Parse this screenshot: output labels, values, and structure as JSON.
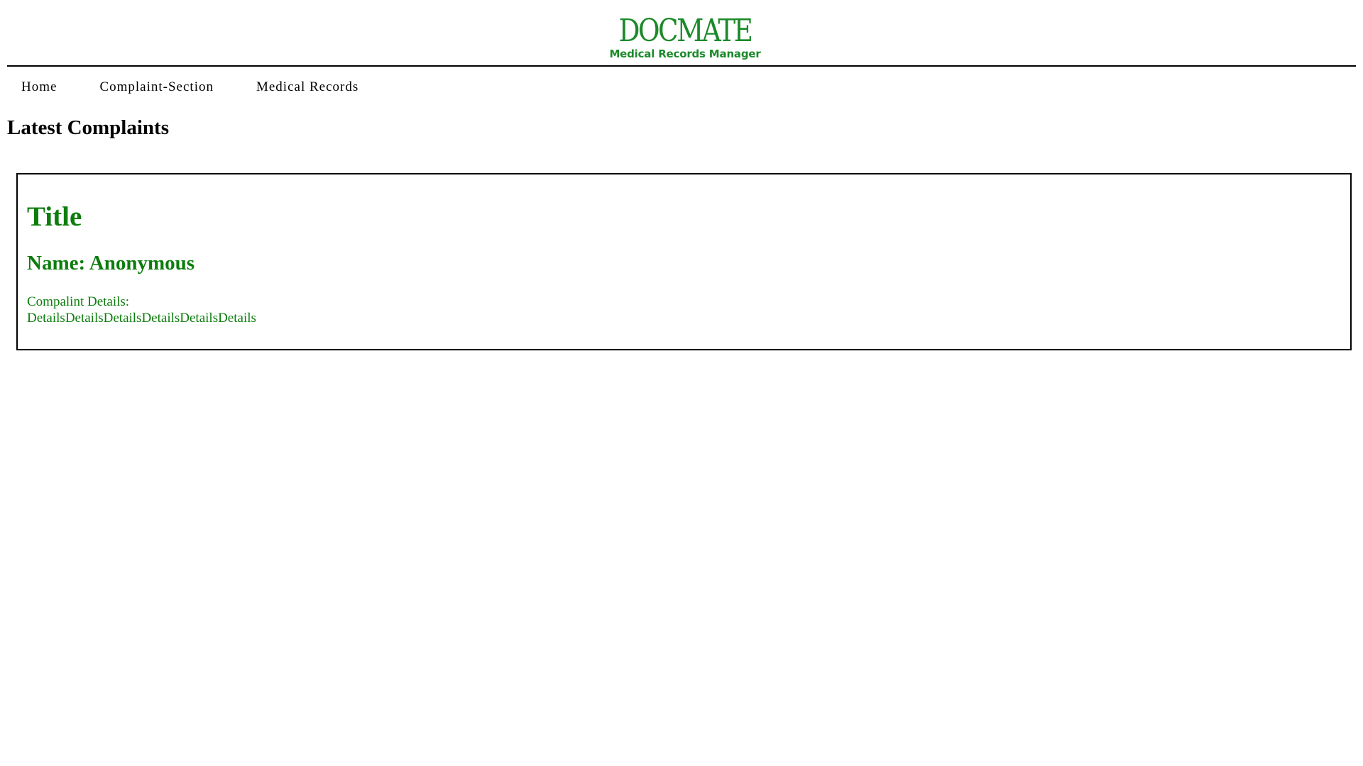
{
  "logo": {
    "wordmark": "DOCMATE",
    "tagline": "Medical Records Manager",
    "color": "#1b8a2a"
  },
  "nav": {
    "items": [
      {
        "label": "Home"
      },
      {
        "label": "Complaint-Section"
      },
      {
        "label": "Medical Records"
      }
    ]
  },
  "main": {
    "heading": "Latest Complaints",
    "complaints": [
      {
        "title": "Title",
        "name": "Name: Anonymous",
        "details_label": "Compalint Details:",
        "details": "DetailsDetailsDetailsDetailsDetailsDetails"
      }
    ],
    "accent_color": "#0c7d0c"
  }
}
